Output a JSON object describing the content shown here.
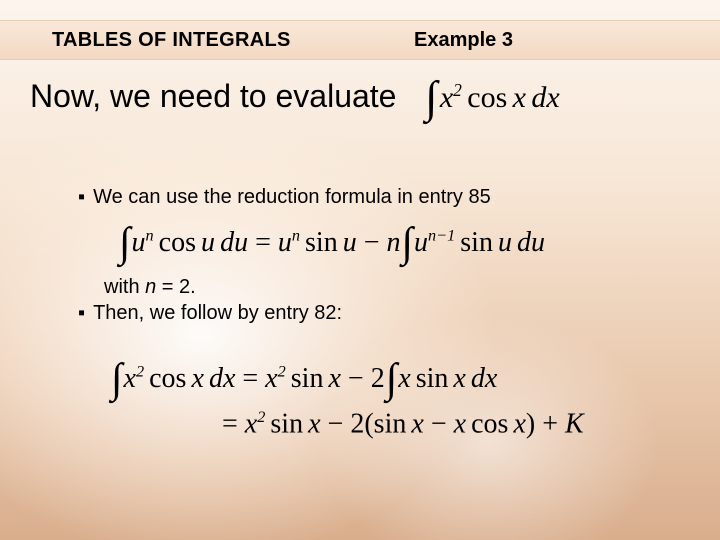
{
  "header": {
    "section_title": "TABLES OF INTEGRALS",
    "example_label": "Example 3"
  },
  "lead_text": "Now, we need to evaluate",
  "lead_integral_html": "<span class='int'>∫</span><span class='spn'></span>x<span class='sup'>2</span><span class='sp'></span><span class='op'>cos</span><span class='sp'></span>x<span class='sp'></span>dx",
  "bullet1_text": "We can use the reduction formula in entry 85",
  "formula1_html": "<span class='int'>∫</span>u<span class='sup'>n</span><span class='sp'></span><span class='op'>cos</span><span class='sp'></span>u<span class='sp'></span>du <span class='op'>=</span> u<span class='sup'>n</span><span class='sp'></span><span class='op'>sin</span><span class='sp'></span>u <span class='op'>−</span> n<span class='int'>∫</span>u<span class='sup'>n−1</span><span class='sp'></span><span class='op'>sin</span><span class='sp'></span>u<span class='sp'></span>du",
  "withn_prefix": "with ",
  "withn_var": "n",
  "withn_suffix": " = 2.",
  "bullet2_text": "Then, we follow by entry 82:",
  "formula2a_html": "<span class='int'>∫</span>x<span class='sup'>2</span><span class='sp'></span><span class='op'>cos</span><span class='sp'></span>x<span class='sp'></span>dx <span class='op'>=</span> x<span class='sup'>2</span><span class='sp'></span><span class='op'>sin</span><span class='sp'></span>x <span class='op'>−</span> <span class='op'>2</span><span class='int'>∫</span>x<span class='sp'></span><span class='op'>sin</span><span class='sp'></span>x<span class='sp'></span>dx",
  "formula2b_html": "<span class='op'>=</span> x<span class='sup'>2</span><span class='sp'></span><span class='op'>sin</span><span class='sp'></span>x <span class='op'>−</span> <span class='op'>2(sin</span><span class='sp'></span>x <span class='op'>−</span> x<span class='sp'></span><span class='op'>cos</span><span class='sp'></span>x<span class='op'>)</span> <span class='op'>+</span> K",
  "entry_numbers": {
    "reduction": 85,
    "followup": 82
  },
  "n_value": 2
}
